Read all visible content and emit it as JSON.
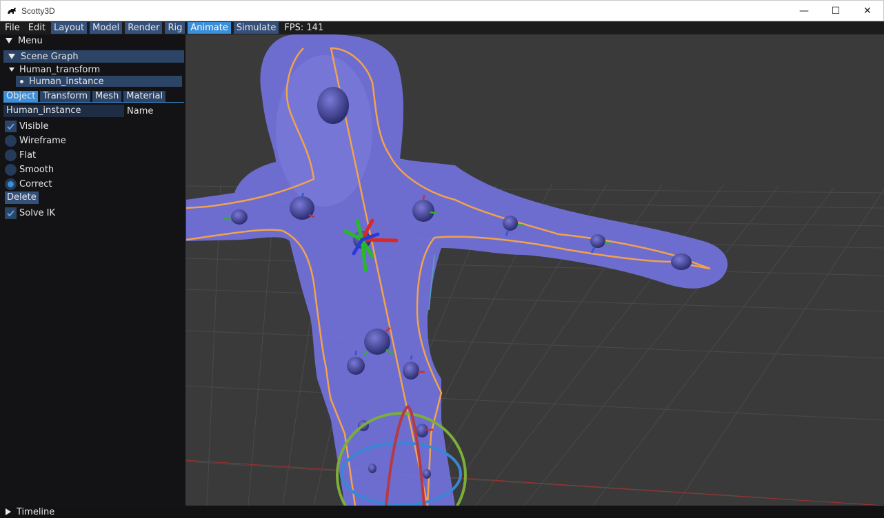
{
  "window": {
    "title": "Scotty3D",
    "controls": {
      "minimize": "—",
      "maximize": "☐",
      "close": "✕"
    }
  },
  "menubar": {
    "items": [
      {
        "label": "File",
        "style": "plain"
      },
      {
        "label": "Edit",
        "style": "plain"
      },
      {
        "label": "Layout",
        "style": "button"
      },
      {
        "label": "Model",
        "style": "button"
      },
      {
        "label": "Render",
        "style": "button"
      },
      {
        "label": "Rig",
        "style": "button"
      },
      {
        "label": "Animate",
        "style": "active"
      },
      {
        "label": "Simulate",
        "style": "button"
      }
    ],
    "fps": "FPS: 141"
  },
  "sidebar": {
    "menu_label": "Menu",
    "scene_graph_label": "Scene Graph",
    "tree": {
      "parent": "Human_transform",
      "child": "Human_instance"
    },
    "tabs": [
      {
        "label": "Object",
        "active": true
      },
      {
        "label": "Transform",
        "active": false
      },
      {
        "label": "Mesh",
        "active": false
      },
      {
        "label": "Material",
        "active": false
      }
    ],
    "name_value": "Human_instance",
    "name_label": "Name",
    "visible": {
      "label": "Visible",
      "checked": true
    },
    "render_modes": [
      {
        "label": "Wireframe",
        "selected": false
      },
      {
        "label": "Flat",
        "selected": false
      },
      {
        "label": "Smooth",
        "selected": false
      },
      {
        "label": "Correct",
        "selected": true
      }
    ],
    "delete_label": "Delete",
    "solve_ik": {
      "label": "Solve IK",
      "checked": true
    }
  },
  "timeline": {
    "label": "Timeline"
  },
  "colors": {
    "accent": "#3b8fd9",
    "button": "#35507a",
    "header": "#2c4466",
    "mesh": "#7070d8",
    "outline": "#f0a050",
    "joint": "#4a4aa0"
  }
}
